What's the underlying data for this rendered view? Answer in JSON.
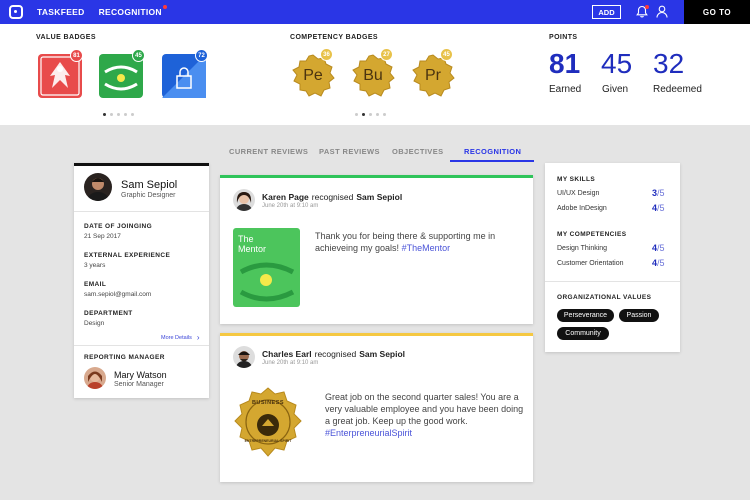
{
  "nav": {
    "taskfeed": "TASKFEED",
    "recognition": "RECOGNITION",
    "add": "ADD",
    "goto": "GO TO"
  },
  "value_badges": {
    "title": "VALUE BADGES",
    "items": [
      {
        "count": "81",
        "icon": "eagle-badge",
        "color": "#e84b4b"
      },
      {
        "count": "45",
        "icon": "mentor-hands-badge",
        "color": "#2ea84a"
      },
      {
        "count": "72",
        "icon": "lock-badge",
        "color": "#1e62d8"
      }
    ]
  },
  "competency_badges": {
    "title": "COMPETENCY BADGES",
    "items": [
      {
        "code": "Pe",
        "count": "36"
      },
      {
        "code": "Bu",
        "count": "27"
      },
      {
        "code": "Pr",
        "count": "45"
      }
    ]
  },
  "points": {
    "title": "POINTS",
    "earned": "81",
    "earned_label": "Earned",
    "given": "45",
    "given_label": "Given",
    "redeemed": "32",
    "redeemed_label": "Redeemed"
  },
  "tabs": {
    "current": "CURRENT REVIEWS",
    "past": "PAST REVIEWS",
    "objectives": "OBJECTIVES",
    "recognition": "RECOGNITION"
  },
  "profile": {
    "name": "Sam Sepiol",
    "role": "Graphic Designer",
    "doj_label": "DATE OF JOINGING",
    "doj": "21 Sep 2017",
    "exp_label": "EXTERNAL EXPERIENCE",
    "exp": "3 years",
    "email_label": "EMAIL",
    "email": "sam.sepiol@gmail.com",
    "dept_label": "DEPARTMENT",
    "dept": "Design",
    "more": "More Details",
    "manager_label": "REPORTING MANAGER",
    "manager_name": "Mary Watson",
    "manager_role": "Senior Manager"
  },
  "posts": [
    {
      "author": "Karen Page",
      "verb": "recognised",
      "target": "Sam Sepiol",
      "time": "June 20th at 9:10 am",
      "badge_title": "The Mentor",
      "text": "Thank you for being there & supporting me in achieveing my goals!",
      "tag": "#TheMentor",
      "accent": "#2fc45a"
    },
    {
      "author": "Charles Earl",
      "verb": "recognised",
      "target": "Sam Sepiol",
      "time": "June 20th at 9:10 am",
      "badge_word": "BUSINESS",
      "badge_arc": "ENTREPRENEURIAL SPIRIT",
      "text": "Great job on the second quarter sales! You are a very valuable employee and you have been doing a great job. Keep up the good work.",
      "tag": "#EnterpreneurialSpirit",
      "accent": "#f5c842"
    }
  ],
  "skills": {
    "title": "MY SKILLS",
    "items": [
      {
        "name": "UI/UX Design",
        "score": "3",
        "max": "/5"
      },
      {
        "name": "Adobe InDesign",
        "score": "4",
        "max": "/5"
      }
    ],
    "comp_title": "MY COMPETENCIES",
    "comps": [
      {
        "name": "Design Thinking",
        "score": "4",
        "max": "/5"
      },
      {
        "name": "Customer Orientation",
        "score": "4",
        "max": "/5"
      }
    ]
  },
  "org_values": {
    "title": "ORGANIZATIONAL VALUES",
    "items": [
      "Perseverance",
      "Passion",
      "Community"
    ]
  }
}
